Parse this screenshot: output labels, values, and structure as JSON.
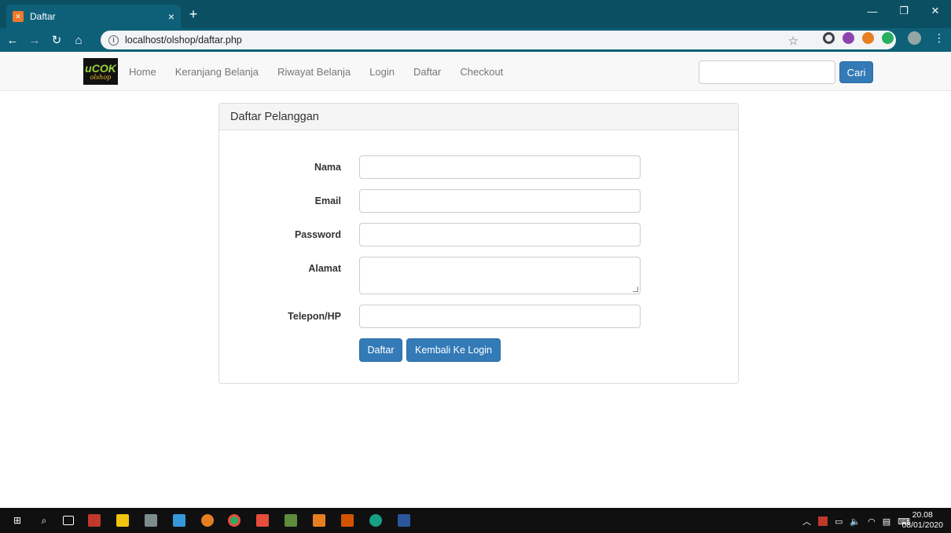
{
  "browser": {
    "tab_title": "Daftar",
    "tab_close": "×",
    "new_tab": "+",
    "url": "localhost/olshop/daftar.php",
    "controls": {
      "minimize": "—",
      "maximize": "❐",
      "close": "✕"
    }
  },
  "navbar": {
    "logo_text_1": "uCOK",
    "logo_text_2": "olshop",
    "links": [
      "Home",
      "Keranjang Belanja",
      "Riwayat Belanja",
      "Login",
      "Daftar",
      "Checkout"
    ],
    "search_placeholder": "",
    "search_button": "Cari"
  },
  "panel": {
    "heading": "Daftar Pelanggan",
    "fields": {
      "nama": "Nama",
      "email": "Email",
      "password": "Password",
      "alamat": "Alamat",
      "telepon": "Telepon/HP"
    },
    "buttons": {
      "daftar": "Daftar",
      "kembali": "Kembali Ke Login"
    }
  },
  "taskbar": {
    "time": "20.08",
    "date": "08/01/2020"
  },
  "colors": {
    "titlebar": "#0b4f63",
    "toolbar": "#0e6079",
    "primary": "#337ab7"
  }
}
